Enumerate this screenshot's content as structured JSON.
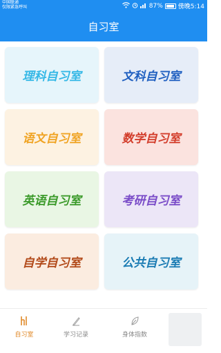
{
  "status_bar": {
    "carrier_line1": "中国联通",
    "carrier_line2": "仅限紧急呼叫",
    "battery": "87%",
    "time": "傍晚5:14"
  },
  "header": {
    "title": "自习室"
  },
  "rooms": [
    {
      "label": "理科自习室",
      "color": "#35b8e6"
    },
    {
      "label": "文科自习室",
      "color": "#1f5fc0"
    },
    {
      "label": "语文自习室",
      "color": "#f0a424"
    },
    {
      "label": "数学自习室",
      "color": "#d33e2c"
    },
    {
      "label": "英语自习室",
      "color": "#3b9a2a"
    },
    {
      "label": "考研自习室",
      "color": "#7a4cc8"
    },
    {
      "label": "自学自习室",
      "color": "#b24a1a"
    },
    {
      "label": "公共自习室",
      "color": "#1a7bb3"
    }
  ],
  "tabs": [
    {
      "label": "自习室",
      "icon": "study-room-icon",
      "active": true
    },
    {
      "label": "学习记录",
      "icon": "pen-icon",
      "active": false
    },
    {
      "label": "身体指数",
      "icon": "leaf-icon",
      "active": false
    }
  ],
  "colors": {
    "primary": "#1f8ef1",
    "active_tab": "#e08a2a",
    "inactive_tab": "#8a8a8a"
  }
}
